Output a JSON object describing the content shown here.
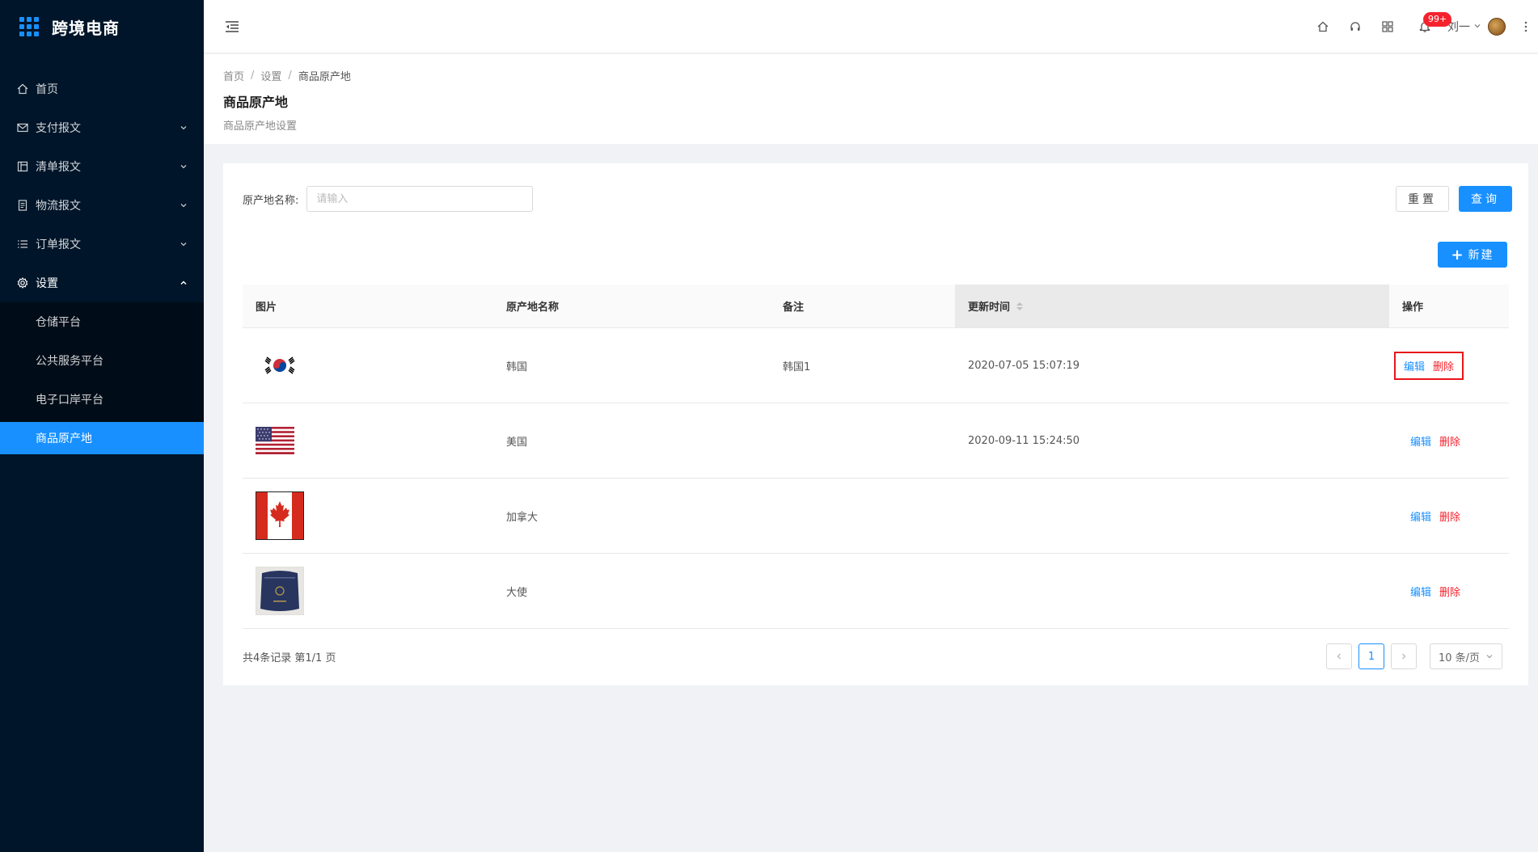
{
  "app": {
    "title": "跨境电商"
  },
  "sidebar": {
    "items": [
      {
        "label": "首页",
        "icon": "home-icon"
      },
      {
        "label": "支付报文",
        "icon": "mail-icon"
      },
      {
        "label": "清单报文",
        "icon": "layout-icon"
      },
      {
        "label": "物流报文",
        "icon": "document-icon"
      },
      {
        "label": "订单报文",
        "icon": "list-icon"
      },
      {
        "label": "设置",
        "icon": "gear-icon"
      }
    ],
    "sub_items": [
      {
        "label": "仓储平台"
      },
      {
        "label": "公共服务平台"
      },
      {
        "label": "电子口岸平台"
      },
      {
        "label": "商品原产地"
      }
    ]
  },
  "header": {
    "notification_badge": "99+",
    "user_name": "刘一"
  },
  "page": {
    "breadcrumb": [
      "首页",
      "设置",
      "商品原产地"
    ],
    "title": "商品原产地",
    "subtitle": "商品原产地设置"
  },
  "search": {
    "label": "原产地名称:",
    "placeholder": "请输入",
    "value": "",
    "reset_label": "重置",
    "query_label": "查询",
    "new_label": "新建"
  },
  "table": {
    "headers": [
      "图片",
      "原产地名称",
      "备注",
      "更新时间",
      "操作"
    ],
    "rows": [
      {
        "image": "south-korea-flag",
        "name": "韩国",
        "remark": "韩国1",
        "updated": "2020-07-05 15:07:19"
      },
      {
        "image": "usa-flag",
        "name": "美国",
        "remark": "",
        "updated": "2020-09-11 15:24:50"
      },
      {
        "image": "canada-flag",
        "name": "加拿大",
        "remark": "",
        "updated": ""
      },
      {
        "image": "passport-photo",
        "name": "大使",
        "remark": "",
        "updated": ""
      }
    ],
    "edit_label": "编辑",
    "delete_label": "删除"
  },
  "pagination": {
    "summary": "共4条记录 第1/1 页",
    "current_page": "1",
    "page_size": "10 条/页"
  },
  "colors": {
    "sidebar_bg": "#001529",
    "accent": "#1890ff",
    "danger": "#f5222d",
    "highlight_box": "#e8141a"
  }
}
